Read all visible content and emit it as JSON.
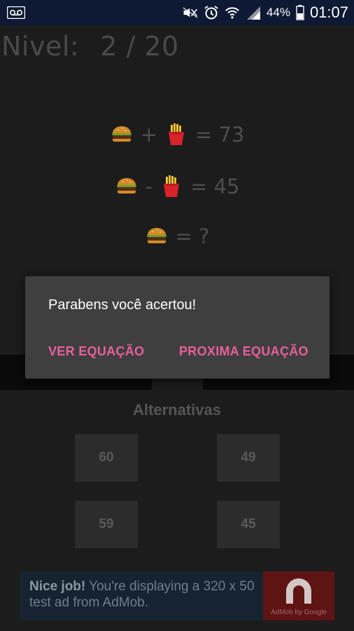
{
  "status_bar": {
    "battery_percent": "44%",
    "time": "01:07"
  },
  "game": {
    "level_label": "Nivel:",
    "level_value": "2 / 20",
    "equations": [
      {
        "operator": "+",
        "result": "= 73"
      },
      {
        "operator": "-",
        "result": "= 45"
      },
      {
        "result": "= ?"
      }
    ]
  },
  "dialog": {
    "message": "Parabens você acertou!",
    "button_see": "VER EQUAÇÃO",
    "button_next": "PROXIMA EQUAÇÃO"
  },
  "alternatives": {
    "title": "Alternativas",
    "options": [
      "60",
      "49",
      "59",
      "45"
    ]
  },
  "ad": {
    "bold": "Nice job!",
    "text": "You're displaying a 320 x 50 test ad from AdMob.",
    "logo_caption": "AdMob by Google"
  },
  "colors": {
    "status_bar": "#0e1a33",
    "background": "#1c1c1c",
    "dialog": "#3f3f3f",
    "accent": "#e8609a"
  },
  "icons": [
    "voicemail-icon",
    "mute-icon",
    "alarm-icon",
    "wifi-icon",
    "signal-icon",
    "battery-icon",
    "burger-icon",
    "fries-icon",
    "admob-logo-icon"
  ]
}
